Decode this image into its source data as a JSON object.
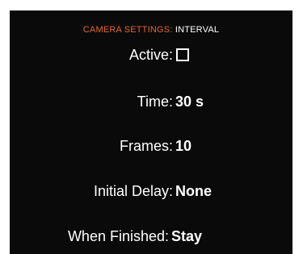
{
  "header": {
    "prefix": "CAMERA SETTINGS:",
    "name": "INTERVAL"
  },
  "settings": {
    "active": {
      "label": "Active:",
      "checked": false
    },
    "time": {
      "label": "Time:",
      "value": "30 s"
    },
    "frames": {
      "label": "Frames:",
      "value": "10"
    },
    "initial_delay": {
      "label": "Initial Delay:",
      "value": "None"
    },
    "when_finished": {
      "label": "When Finished:",
      "value": "Stay"
    }
  },
  "colors": {
    "background": "#0a0a0a",
    "accent": "#e0672f",
    "text": "#ffffff"
  }
}
